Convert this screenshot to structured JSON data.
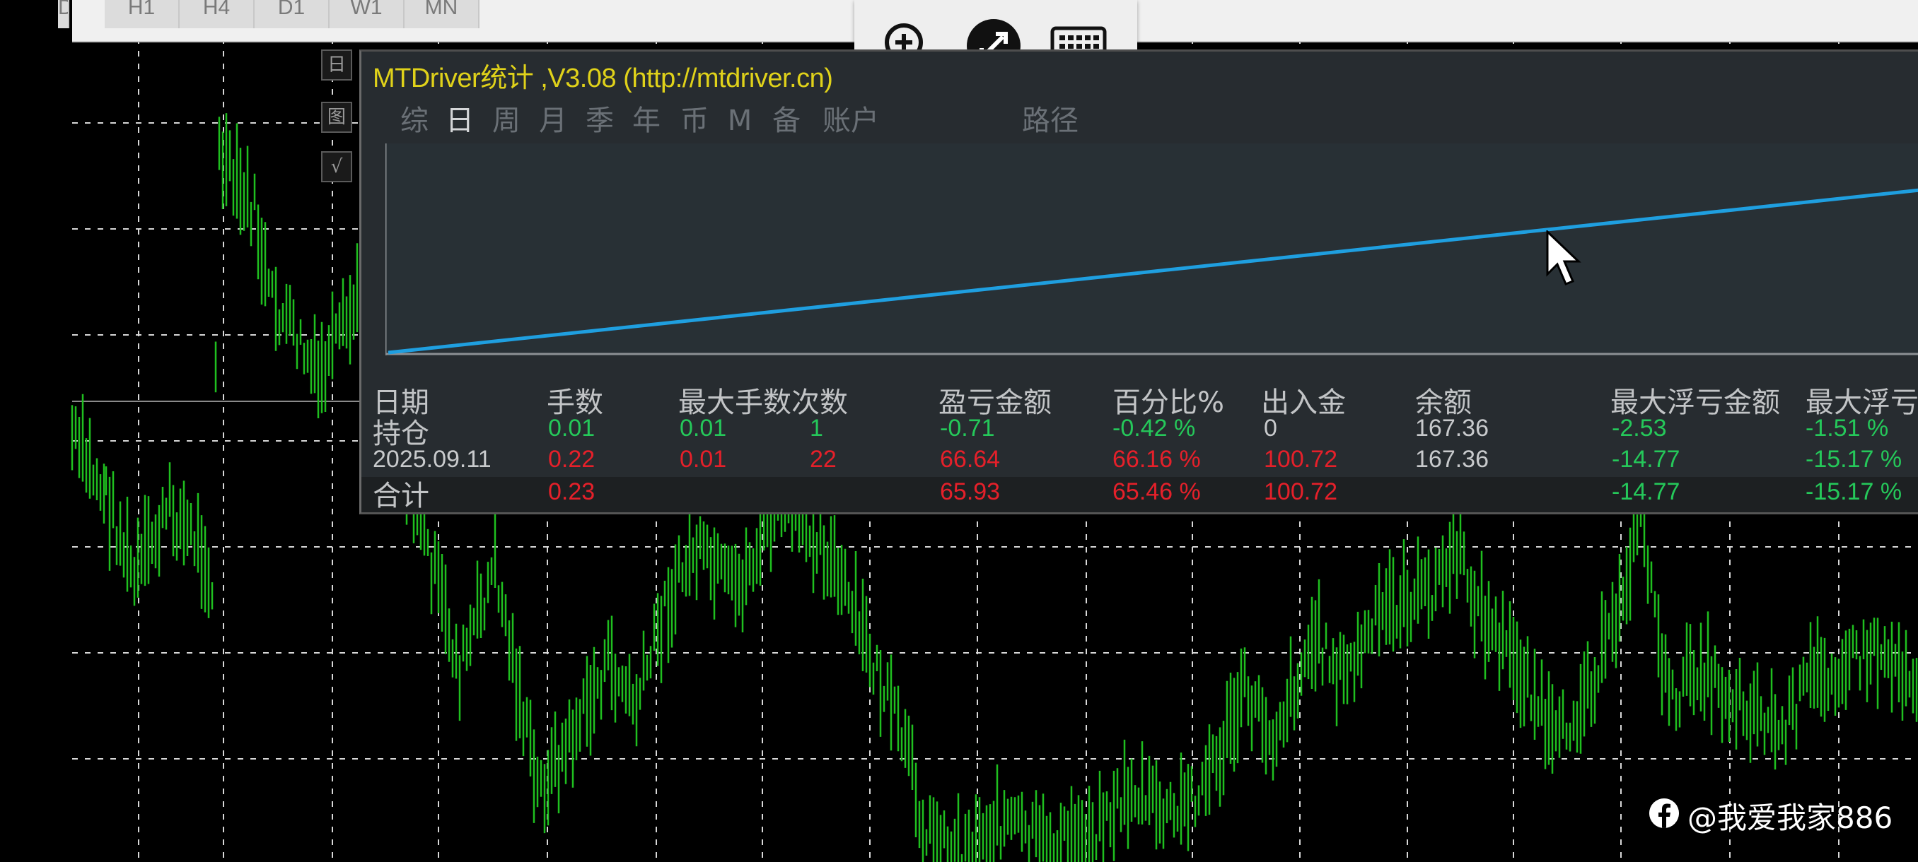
{
  "timeframes": [
    "D",
    "H1",
    "H4",
    "D1",
    "W1",
    "MN"
  ],
  "remote_toolbar": {
    "icons": [
      "zoom-in-icon",
      "remote-desktop-icon",
      "keyboard-icon"
    ]
  },
  "side_icons": [
    "日",
    "图",
    "√"
  ],
  "panel": {
    "title": "MTDriver统计 ,V3.08 (http://mtdriver.cn)",
    "tabs": [
      "综",
      "日",
      "周",
      "月",
      "季",
      "年",
      "币",
      "M",
      "备",
      "账户",
      "路径"
    ],
    "active_tab": "日",
    "equity_line_color": "#1f9fe0"
  },
  "stats_table": {
    "headers": [
      "日期",
      "手数",
      "最大手数",
      "次数",
      "盈亏金额",
      "百分比%",
      "出入金",
      "余额",
      "最大浮亏金额",
      "最大浮亏"
    ],
    "rows": [
      {
        "date": "持仓",
        "lots": "0.01",
        "max_lots": "0.01",
        "count": "1",
        "pnl": "-0.71",
        "pct": "-0.42 %",
        "deposit": "0",
        "balance": "167.36",
        "max_float_loss": "-2.53",
        "max_float_pct": "-1.51 %"
      },
      {
        "date": "2025.09.11",
        "lots": "0.22",
        "max_lots": "0.01",
        "count": "22",
        "pnl": "66.64",
        "pct": "66.16 %",
        "deposit": "100.72",
        "balance": "167.36",
        "max_float_loss": "-14.77",
        "max_float_pct": "-15.17 %"
      },
      {
        "date": "合计",
        "lots": "0.23",
        "max_lots": "",
        "count": "",
        "pnl": "65.93",
        "pct": "65.46 %",
        "deposit": "100.72",
        "balance": "",
        "max_float_loss": "-14.77",
        "max_float_pct": "-15.17 %"
      }
    ]
  },
  "watermark": "@我爱我家886",
  "colors": {
    "candle": "#1fbf1f",
    "grid": "#d8d8d8",
    "title": "#e0d21a",
    "profit": "#e5202a",
    "neutral": "#25c85a"
  }
}
